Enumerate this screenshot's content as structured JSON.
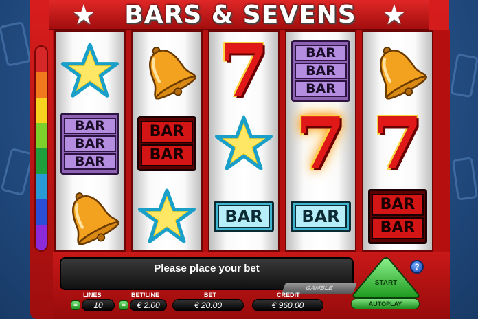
{
  "title": "BARS & SEVENS",
  "star_glyph": "★",
  "reels": [
    [
      {
        "symbol": "star-icon"
      },
      {
        "symbol": "bar3",
        "text": [
          "BAR",
          "BAR",
          "BAR"
        ]
      },
      {
        "symbol": "bell-icon"
      }
    ],
    [
      {
        "symbol": "bell-icon"
      },
      {
        "symbol": "bar2",
        "text": [
          "BAR",
          "BAR"
        ]
      },
      {
        "symbol": "star-icon"
      }
    ],
    [
      {
        "symbol": "seven",
        "text": "7"
      },
      {
        "symbol": "star-icon"
      },
      {
        "symbol": "bar1",
        "text": "BAR"
      }
    ],
    [
      {
        "symbol": "bar3",
        "text": [
          "BAR",
          "BAR",
          "BAR"
        ]
      },
      {
        "symbol": "seven-fire",
        "text": "7"
      },
      {
        "symbol": "bar1",
        "text": "BAR"
      }
    ],
    [
      {
        "symbol": "bell-icon"
      },
      {
        "symbol": "seven",
        "text": "7"
      },
      {
        "symbol": "bar2",
        "text": [
          "BAR",
          "BAR"
        ]
      }
    ]
  ],
  "panel": {
    "message": "Please place your bet",
    "gamble_label": "GAMBLE",
    "lines_label": "LINES",
    "lines_value": "10",
    "betline_label": "BET/LINE",
    "betline_value": "€ 2.00",
    "bet_label": "BET",
    "bet_value": "€ 20.00",
    "credit_label": "CREDIT",
    "credit_value": "€ 960.00",
    "start_label": "START",
    "autoplay_label": "AUTOPLAY",
    "help_label": "?",
    "stepper_glyph": "≡"
  },
  "colors": {
    "rainbow": [
      "#d62828",
      "#f2781e",
      "#f7d21e",
      "#7dcf2b",
      "#1e9e3c",
      "#2a9ad6",
      "#2a4fd6",
      "#8b2ad6"
    ]
  }
}
